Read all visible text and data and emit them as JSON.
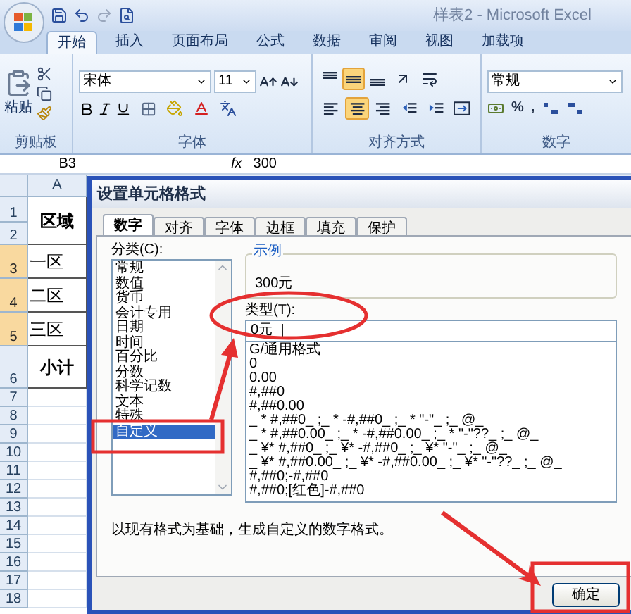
{
  "window": {
    "title": "样表2 - Microsoft Excel"
  },
  "ribbon_tabs": [
    {
      "label": "开始",
      "selected": true
    },
    {
      "label": "插入",
      "selected": false
    },
    {
      "label": "页面布局",
      "selected": false
    },
    {
      "label": "公式",
      "selected": false
    },
    {
      "label": "数据",
      "selected": false
    },
    {
      "label": "审阅",
      "selected": false
    },
    {
      "label": "视图",
      "selected": false
    },
    {
      "label": "加载项",
      "selected": false
    }
  ],
  "ribbon": {
    "clipboard": {
      "paste_label": "粘贴",
      "group_label": "剪贴板"
    },
    "font": {
      "font_name": "宋体",
      "font_size": "11",
      "group_label": "字体"
    },
    "alignment": {
      "group_label": "对齐方式",
      "buttons": [
        {
          "kind": "top",
          "selected": false
        },
        {
          "kind": "middle",
          "selected": true
        },
        {
          "kind": "bottom",
          "selected": false
        },
        {
          "kind": "orientation",
          "selected": false
        },
        {
          "kind": "wrap",
          "selected": false
        },
        {
          "kind": "left",
          "selected": false
        },
        {
          "kind": "center",
          "selected": true
        },
        {
          "kind": "right",
          "selected": false
        },
        {
          "kind": "outdent",
          "selected": false
        },
        {
          "kind": "indent",
          "selected": false
        },
        {
          "kind": "merge",
          "selected": false
        }
      ]
    },
    "number": {
      "format": "常规",
      "percent": "%",
      "comma": ",",
      "group_label": "数字"
    }
  },
  "formula_bar": {
    "name_box": "B3",
    "function_label": "fx",
    "value": "300"
  },
  "sheet": {
    "columns": [
      "A"
    ],
    "rows": [
      {
        "kind": "heading",
        "headers": [
          "1",
          "2"
        ],
        "cell": "区域",
        "selected": false
      },
      {
        "kind": "item",
        "headers": [
          "3"
        ],
        "cell": "一区",
        "selected": true
      },
      {
        "kind": "item",
        "headers": [
          "4"
        ],
        "cell": "二区",
        "selected": true
      },
      {
        "kind": "item",
        "headers": [
          "5"
        ],
        "cell": "三区",
        "selected": true
      },
      {
        "kind": "total",
        "headers": [
          "6"
        ],
        "cell": "小计",
        "selected": false
      },
      {
        "kind": "blank",
        "headers": [
          "7"
        ],
        "selected": false
      },
      {
        "kind": "blank",
        "headers": [
          "8"
        ],
        "selected": false
      },
      {
        "kind": "blank",
        "headers": [
          "9"
        ],
        "selected": false
      },
      {
        "kind": "blank",
        "headers": [
          "10"
        ],
        "selected": false
      },
      {
        "kind": "blank",
        "headers": [
          "11"
        ],
        "selected": false
      },
      {
        "kind": "blank",
        "headers": [
          "12"
        ],
        "selected": false
      },
      {
        "kind": "blank",
        "headers": [
          "13"
        ],
        "selected": false
      },
      {
        "kind": "blank",
        "headers": [
          "14"
        ],
        "selected": false
      },
      {
        "kind": "blank",
        "headers": [
          "15"
        ],
        "selected": false
      },
      {
        "kind": "blank",
        "headers": [
          "16"
        ],
        "selected": false
      },
      {
        "kind": "blank",
        "headers": [
          "17"
        ],
        "selected": false
      },
      {
        "kind": "blank",
        "headers": [
          "18"
        ],
        "selected": false
      }
    ]
  },
  "dialog": {
    "title": "设置单元格格式",
    "tabs": [
      {
        "label": "数字",
        "selected": true
      },
      {
        "label": "对齐",
        "selected": false
      },
      {
        "label": "字体",
        "selected": false
      },
      {
        "label": "边框",
        "selected": false
      },
      {
        "label": "填充",
        "selected": false
      },
      {
        "label": "保护",
        "selected": false
      }
    ],
    "category_label": "分类(C):",
    "categories": [
      {
        "label": "常规",
        "selected": false
      },
      {
        "label": "数值",
        "selected": false
      },
      {
        "label": "货币",
        "selected": false
      },
      {
        "label": "会计专用",
        "selected": false
      },
      {
        "label": "日期",
        "selected": false
      },
      {
        "label": "时间",
        "selected": false
      },
      {
        "label": "百分比",
        "selected": false
      },
      {
        "label": "分数",
        "selected": false
      },
      {
        "label": "科学记数",
        "selected": false
      },
      {
        "label": "文本",
        "selected": false
      },
      {
        "label": "特殊",
        "selected": false
      },
      {
        "label": "自定义",
        "selected": true
      }
    ],
    "sample_label": "示例",
    "sample_value": "300元",
    "type_label": "类型(T):",
    "type_value": "0元",
    "formats": [
      "G/通用格式",
      "0",
      "0.00",
      "#,##0",
      "#,##0.00",
      "_ * #,##0_ ;_ * -#,##0_ ;_ * \"-\"_ ;_ @_",
      "_ * #,##0.00_ ;_ * -#,##0.00_ ;_ * \"-\"??_ ;_ @_",
      "_ ¥* #,##0_ ;_ ¥* -#,##0_ ;_ ¥* \"-\"_ ;_ @_",
      "_ ¥* #,##0.00_ ;_ ¥* -#,##0.00_ ;_ ¥* \"-\"??_ ;_ @_",
      "#,##0;-#,##0",
      "#,##0;[红色]-#,##0"
    ],
    "description": "以现有格式为基础，生成自定义的数字格式。",
    "ok_button": "确定"
  }
}
